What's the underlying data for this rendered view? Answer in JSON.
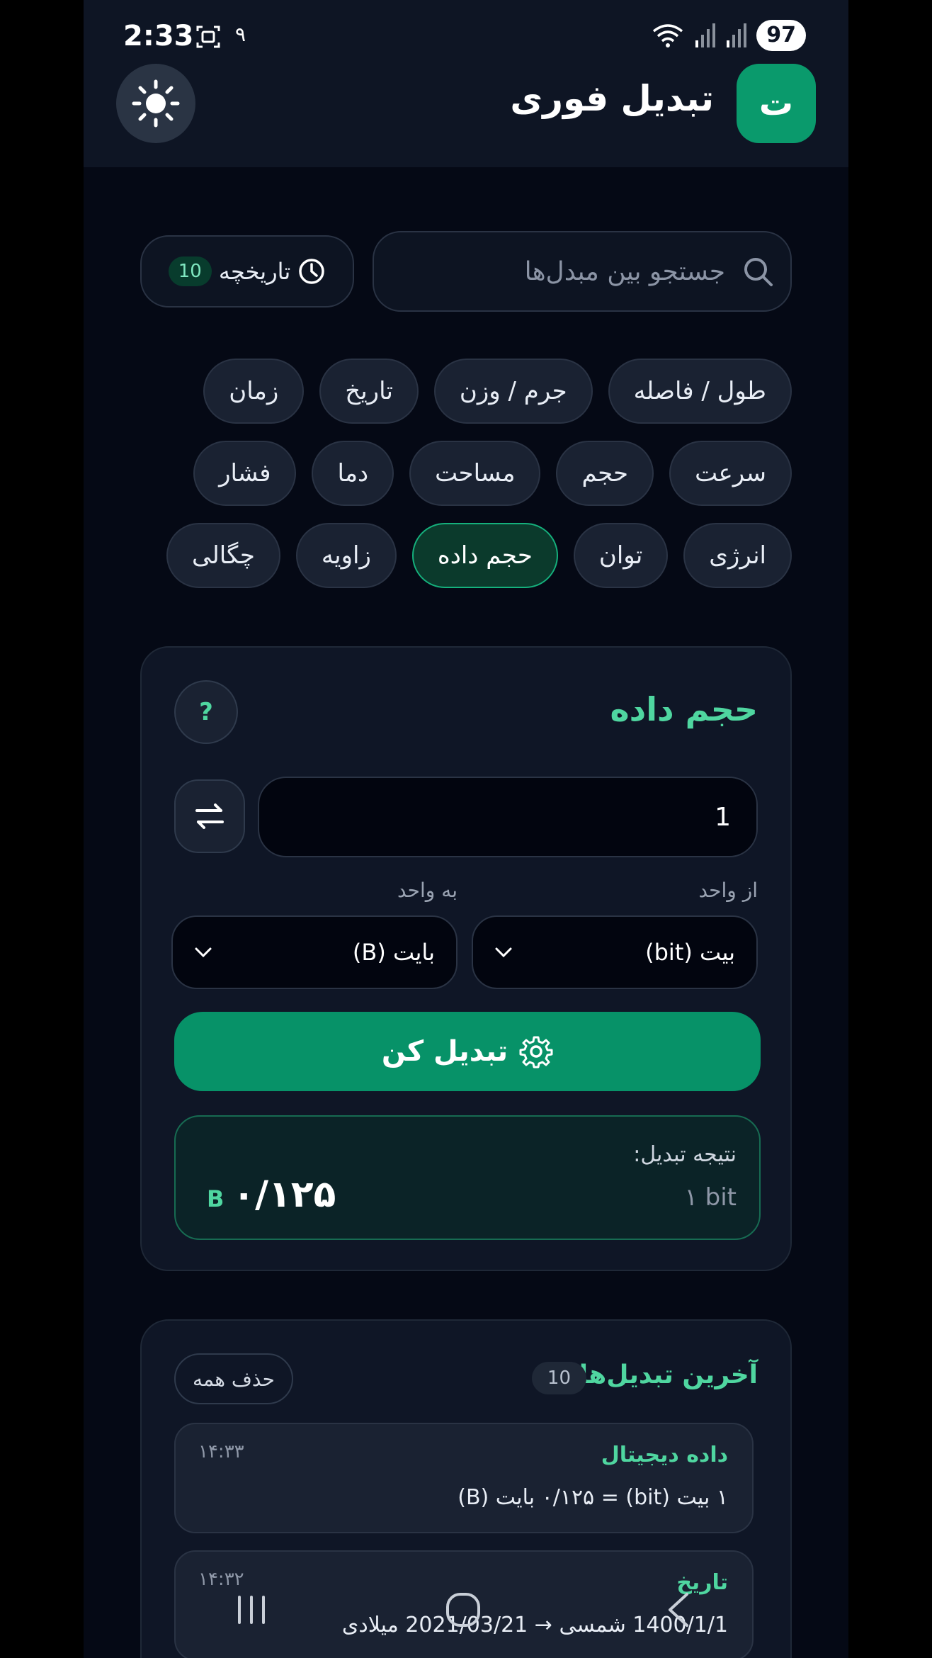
{
  "status": {
    "time": "2:33",
    "extra": "۹",
    "battery": "97"
  },
  "header": {
    "title": "تبدیل فوری",
    "logo_letter": "ت"
  },
  "search": {
    "placeholder": "جستجو بین مبدل‌ها",
    "value": ""
  },
  "history": {
    "label": "تاریخچه",
    "count": "10"
  },
  "categories": [
    {
      "label": "طول / فاصله",
      "active": false
    },
    {
      "label": "جرم / وزن",
      "active": false
    },
    {
      "label": "تاریخ",
      "active": false
    },
    {
      "label": "زمان",
      "active": false
    },
    {
      "label": "سرعت",
      "active": false
    },
    {
      "label": "حجم",
      "active": false
    },
    {
      "label": "مساحت",
      "active": false
    },
    {
      "label": "دما",
      "active": false
    },
    {
      "label": "فشار",
      "active": false
    },
    {
      "label": "انرژی",
      "active": false
    },
    {
      "label": "توان",
      "active": false
    },
    {
      "label": "حجم داده",
      "active": true
    },
    {
      "label": "زاویه",
      "active": false
    },
    {
      "label": "چگالی",
      "active": false
    }
  ],
  "converter": {
    "title": "حجم داده",
    "help": "?",
    "input_value": "1",
    "from_label": "از واحد",
    "to_label": "به واحد",
    "from_unit": "بیت (bit)",
    "to_unit": "بایت (B)",
    "convert_label": "تبدیل کن",
    "result_label": "نتیجه تبدیل:",
    "result_input": "۱ bit",
    "result_value": "۰/۱۲۵",
    "result_unit": "B"
  },
  "recent": {
    "title": "آخرین تبدیل‌ها",
    "count": "10",
    "clear_label": "حذف همه",
    "items": [
      {
        "title": "داده دیجیتال",
        "time": "۱۴:۳۳",
        "detail": "۱ بیت (bit) = ۰/۱۲۵ بایت (B)"
      },
      {
        "title": "تاریخ",
        "time": "۱۴:۳۲",
        "detail": "1400/1/1 شمسی → 2021/03/21 میلادی"
      }
    ]
  },
  "colors": {
    "accent": "#079268",
    "accent_text": "#4fd6a0",
    "background": "#050915",
    "surface": "#0f1626"
  }
}
